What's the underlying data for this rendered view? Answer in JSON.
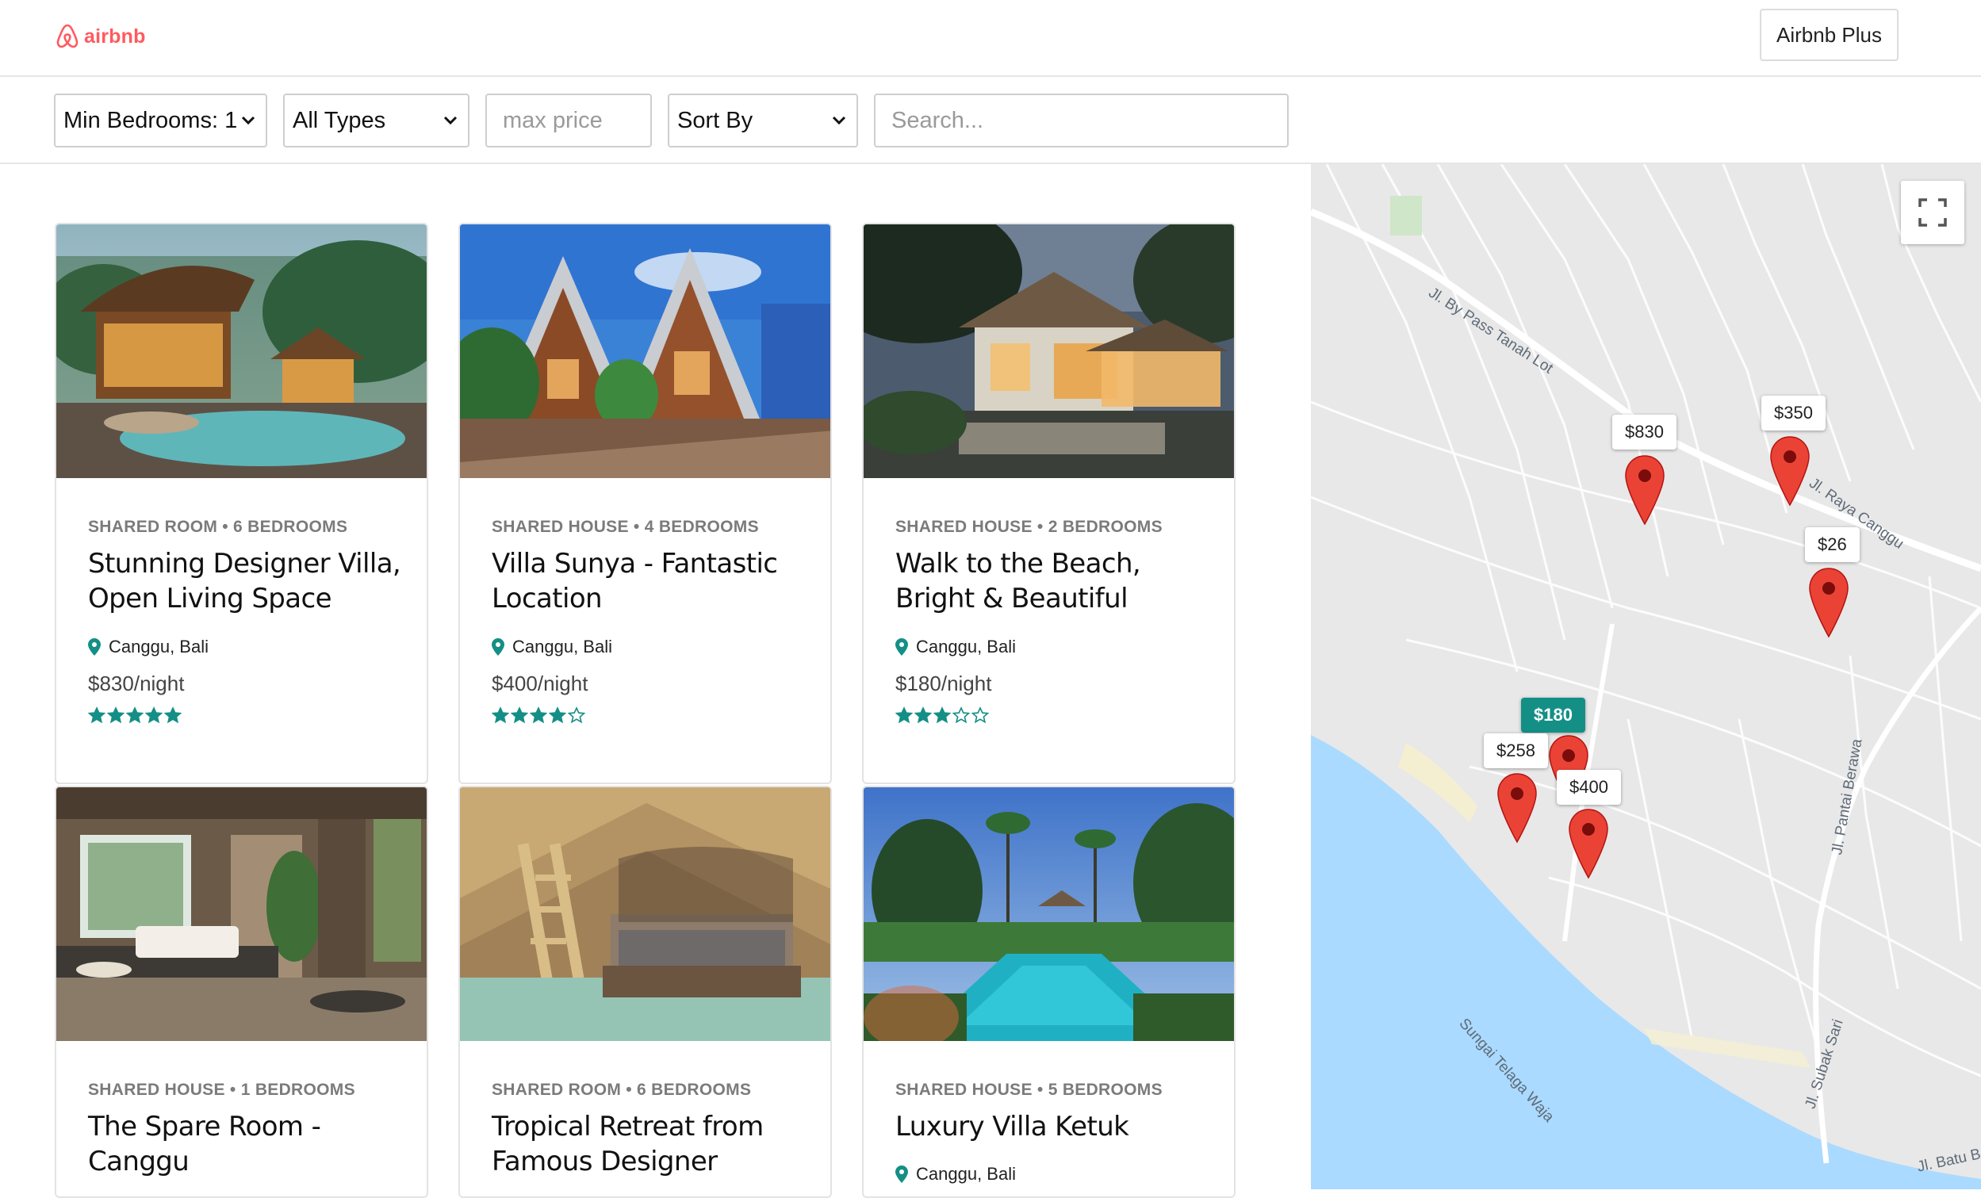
{
  "header": {
    "logo_text": "airbnb",
    "plus_button": "Airbnb Plus"
  },
  "filters": {
    "bedrooms": "Min Bedrooms: 1",
    "types": "All Types",
    "max_price_placeholder": "max price",
    "sort": "Sort By",
    "search_placeholder": "Search..."
  },
  "listings": [
    {
      "meta": "SHARED ROOM • 6 BEDROOMS",
      "title": "Stunning Designer Villa, Open Living Space",
      "location": "Canggu, Bali",
      "price": "$830/night",
      "rating": 5
    },
    {
      "meta": "SHARED HOUSE • 4 BEDROOMS",
      "title": "Villa Sunya - Fantastic Location",
      "location": "Canggu, Bali",
      "price": "$400/night",
      "rating": 4
    },
    {
      "meta": "SHARED HOUSE • 2 BEDROOMS",
      "title": "Walk to the Beach, Bright & Beautiful",
      "location": "Canggu, Bali",
      "price": "$180/night",
      "rating": 3
    },
    {
      "meta": "SHARED HOUSE • 1 BEDROOMS",
      "title": "The Spare Room - Canggu",
      "location": "",
      "price": "",
      "rating": 0
    },
    {
      "meta": "SHARED ROOM • 6 BEDROOMS",
      "title": "Tropical Retreat from Famous Designer",
      "location": "",
      "price": "",
      "rating": 0
    },
    {
      "meta": "SHARED HOUSE • 5 BEDROOMS",
      "title": "Luxury Villa Ketuk",
      "location": "Canggu, Bali",
      "price": "",
      "rating": 0
    }
  ],
  "map": {
    "markers": [
      {
        "label": "$830",
        "active": false
      },
      {
        "label": "$350",
        "active": false
      },
      {
        "label": "$26",
        "active": false
      },
      {
        "label": "$180",
        "active": true
      },
      {
        "label": "$258",
        "active": false
      },
      {
        "label": "$400",
        "active": false
      }
    ],
    "road_labels": [
      "Jl. By Pass Tanah Lot",
      "Jl. Raya Canggu",
      "Jl. Pantai Berawa",
      "Sungai Telaga Waja",
      "Jl. Subak Sari",
      "Jl. Batu B"
    ]
  },
  "colors": {
    "brand": "#ff5a5f",
    "accent": "#148f86",
    "pin": "#ea4335",
    "sea": "#aadaff"
  },
  "icons": {
    "location": "map-pin-icon",
    "star": "star-icon",
    "fullscreen": "fullscreen-icon",
    "chevron": "chevron-down-icon",
    "logo": "airbnb-logo-icon"
  }
}
